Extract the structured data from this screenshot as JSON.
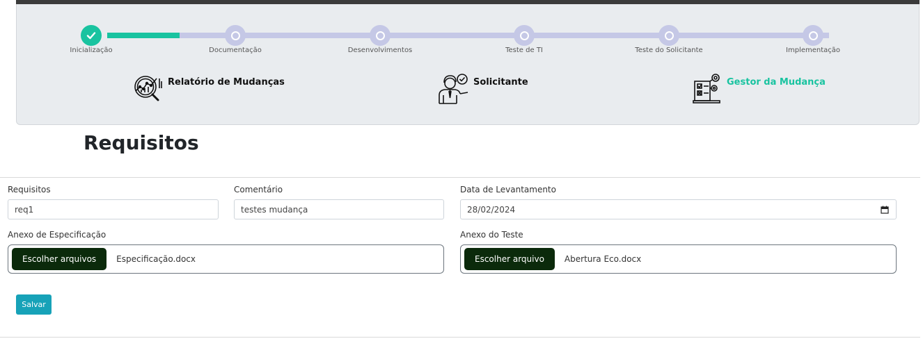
{
  "steps": [
    {
      "label": "Inicialização",
      "state": "done"
    },
    {
      "label": "Documentação",
      "state": "pending"
    },
    {
      "label": "Desenvolvimentos",
      "state": "pending"
    },
    {
      "label": "Teste de TI",
      "state": "pending"
    },
    {
      "label": "Teste do Solicitante",
      "state": "pending"
    },
    {
      "label": "Implementação",
      "state": "pending"
    }
  ],
  "progress_fraction": 0.1,
  "roles": [
    {
      "label": "Relatório de Mudanças",
      "icon": "report-analysis-icon",
      "active": false
    },
    {
      "label": "Solicitante",
      "icon": "requester-person-icon",
      "active": false
    },
    {
      "label": "Gestor da Mudança",
      "icon": "change-manager-icon",
      "active": true
    }
  ],
  "page_title": "Requisitos",
  "form": {
    "requisitos": {
      "label": "Requisitos",
      "value": "req1"
    },
    "comentario": {
      "label": "Comentário",
      "value": "testes mudança"
    },
    "data_levantamento": {
      "label": "Data de Levantamento",
      "value": "28/02/2024"
    },
    "anexo_especificacao": {
      "label": "Anexo de Especificação",
      "button": "Escolher arquivos",
      "file": "Especificação.docx"
    },
    "anexo_teste": {
      "label": "Anexo do Teste",
      "button": "Escolher arquivo",
      "file": "Abertura Eco.docx"
    }
  },
  "save_label": "Salvar",
  "colors": {
    "accent": "#19c3a0",
    "track": "#c5c8e6",
    "file_button": "#0b2a0b",
    "save_button": "#17a2b8"
  }
}
